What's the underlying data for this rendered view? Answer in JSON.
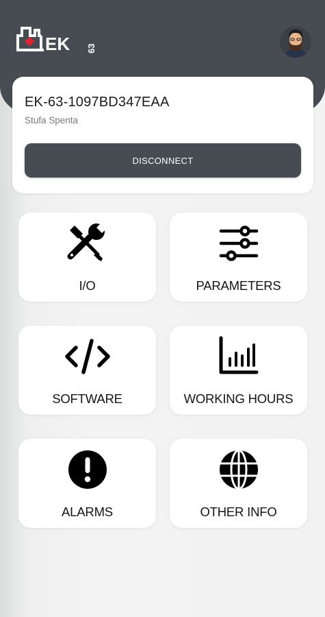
{
  "brand": {
    "logo_text": "EK",
    "logo_number": "63",
    "accent_red": "#e1232b",
    "header_color": "#474c52"
  },
  "user": {
    "avatar_icon": "user-avatar"
  },
  "device": {
    "name": "EK-63-1097BD347EAA",
    "status": "Stufa Spenta",
    "disconnect_label": "DISCONNECT"
  },
  "tiles": [
    {
      "label": "I/O",
      "icon": "tools-icon"
    },
    {
      "label": "PARAMETERS",
      "icon": "sliders-icon"
    },
    {
      "label": "SOFTWARE",
      "icon": "code-icon"
    },
    {
      "label": "WORKING HOURS",
      "icon": "bar-chart-icon"
    },
    {
      "label": "ALARMS",
      "icon": "alert-icon"
    },
    {
      "label": "OTHER INFO",
      "icon": "globe-icon"
    }
  ]
}
